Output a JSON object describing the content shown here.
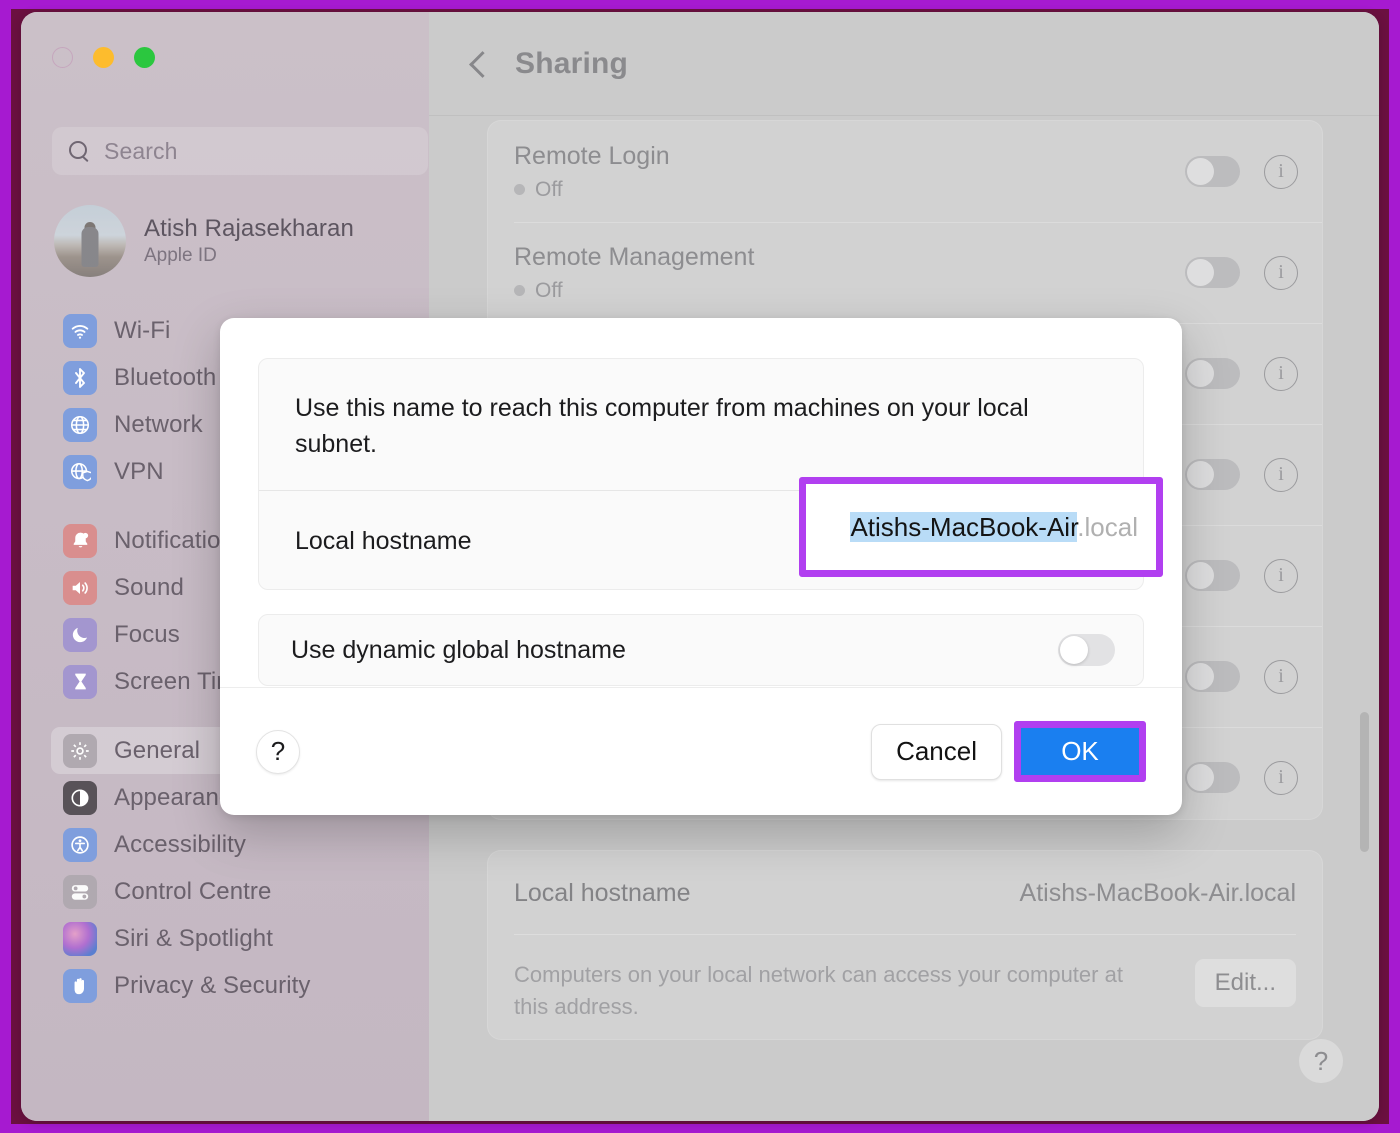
{
  "window": {
    "traffic_lights": [
      "close",
      "minimize",
      "maximize"
    ]
  },
  "sidebar": {
    "search": {
      "placeholder": "Search",
      "icon": "search-icon"
    },
    "profile": {
      "name": "Atish Rajasekharan",
      "subtitle": "Apple ID"
    },
    "groups": [
      {
        "items": [
          {
            "label": "Wi-Fi",
            "icon": "wifi-icon"
          },
          {
            "label": "Bluetooth",
            "icon": "bluetooth-icon"
          },
          {
            "label": "Network",
            "icon": "network-globe-icon"
          },
          {
            "label": "VPN",
            "icon": "vpn-shield-globe-icon"
          }
        ]
      },
      {
        "items": [
          {
            "label": "Notifications",
            "icon": "notifications-bell-icon"
          },
          {
            "label": "Sound",
            "icon": "sound-speaker-icon"
          },
          {
            "label": "Focus",
            "icon": "focus-moon-icon"
          },
          {
            "label": "Screen Time",
            "icon": "screen-time-hourglass-icon"
          }
        ]
      },
      {
        "items": [
          {
            "label": "General",
            "icon": "general-gear-icon",
            "selected": true
          },
          {
            "label": "Appearance",
            "icon": "appearance-contrast-icon"
          },
          {
            "label": "Accessibility",
            "icon": "accessibility-icon"
          },
          {
            "label": "Control Centre",
            "icon": "control-centre-sliders-icon"
          },
          {
            "label": "Siri & Spotlight",
            "icon": "siri-orb-icon"
          },
          {
            "label": "Privacy & Security",
            "icon": "privacy-hand-icon"
          }
        ]
      }
    ]
  },
  "main": {
    "header": {
      "back_icon": "chevron-left-icon",
      "title": "Sharing"
    },
    "services": [
      {
        "name": "Remote Login",
        "state": "Off",
        "toggle": "off",
        "info_icon": "info-circle-icon"
      },
      {
        "name": "Remote Management",
        "state": "Off",
        "toggle": "off",
        "info_icon": "info-circle-icon"
      },
      {
        "name": "",
        "state": "",
        "toggle": "off",
        "info_icon": "info-circle-icon"
      },
      {
        "name": "",
        "state": "",
        "toggle": "off",
        "info_icon": "info-circle-icon"
      },
      {
        "name": "",
        "state": "",
        "toggle": "off",
        "info_icon": "info-circle-icon"
      },
      {
        "name": "",
        "state": "",
        "toggle": "off",
        "info_icon": "info-circle-icon"
      },
      {
        "name": "",
        "state": "",
        "toggle": "off",
        "info_icon": "info-circle-icon"
      }
    ],
    "hostname_card": {
      "label": "Local hostname",
      "value": "Atishs-MacBook-Air.local",
      "description": "Computers on your local network can access your computer at this address.",
      "edit_label": "Edit..."
    },
    "help_label": "?"
  },
  "sheet": {
    "description": "Use this name to reach this computer from machines on your local subnet.",
    "local_hostname_label": "Local hostname",
    "hostname_selected_text": "Atishs-MacBook-Air",
    "hostname_suffix": ".local",
    "dynamic_label": "Use dynamic global hostname",
    "dynamic_toggle": "off",
    "help_label": "?",
    "cancel_label": "Cancel",
    "ok_label": "OK"
  },
  "annotations": {
    "highlight_color": "#b13ff0",
    "frame_outer_color": "#a61ad0",
    "frame_inner_color": "#6b1040",
    "ok_button_color": "#1a7ff0",
    "selection_color": "#b9dcf7"
  }
}
